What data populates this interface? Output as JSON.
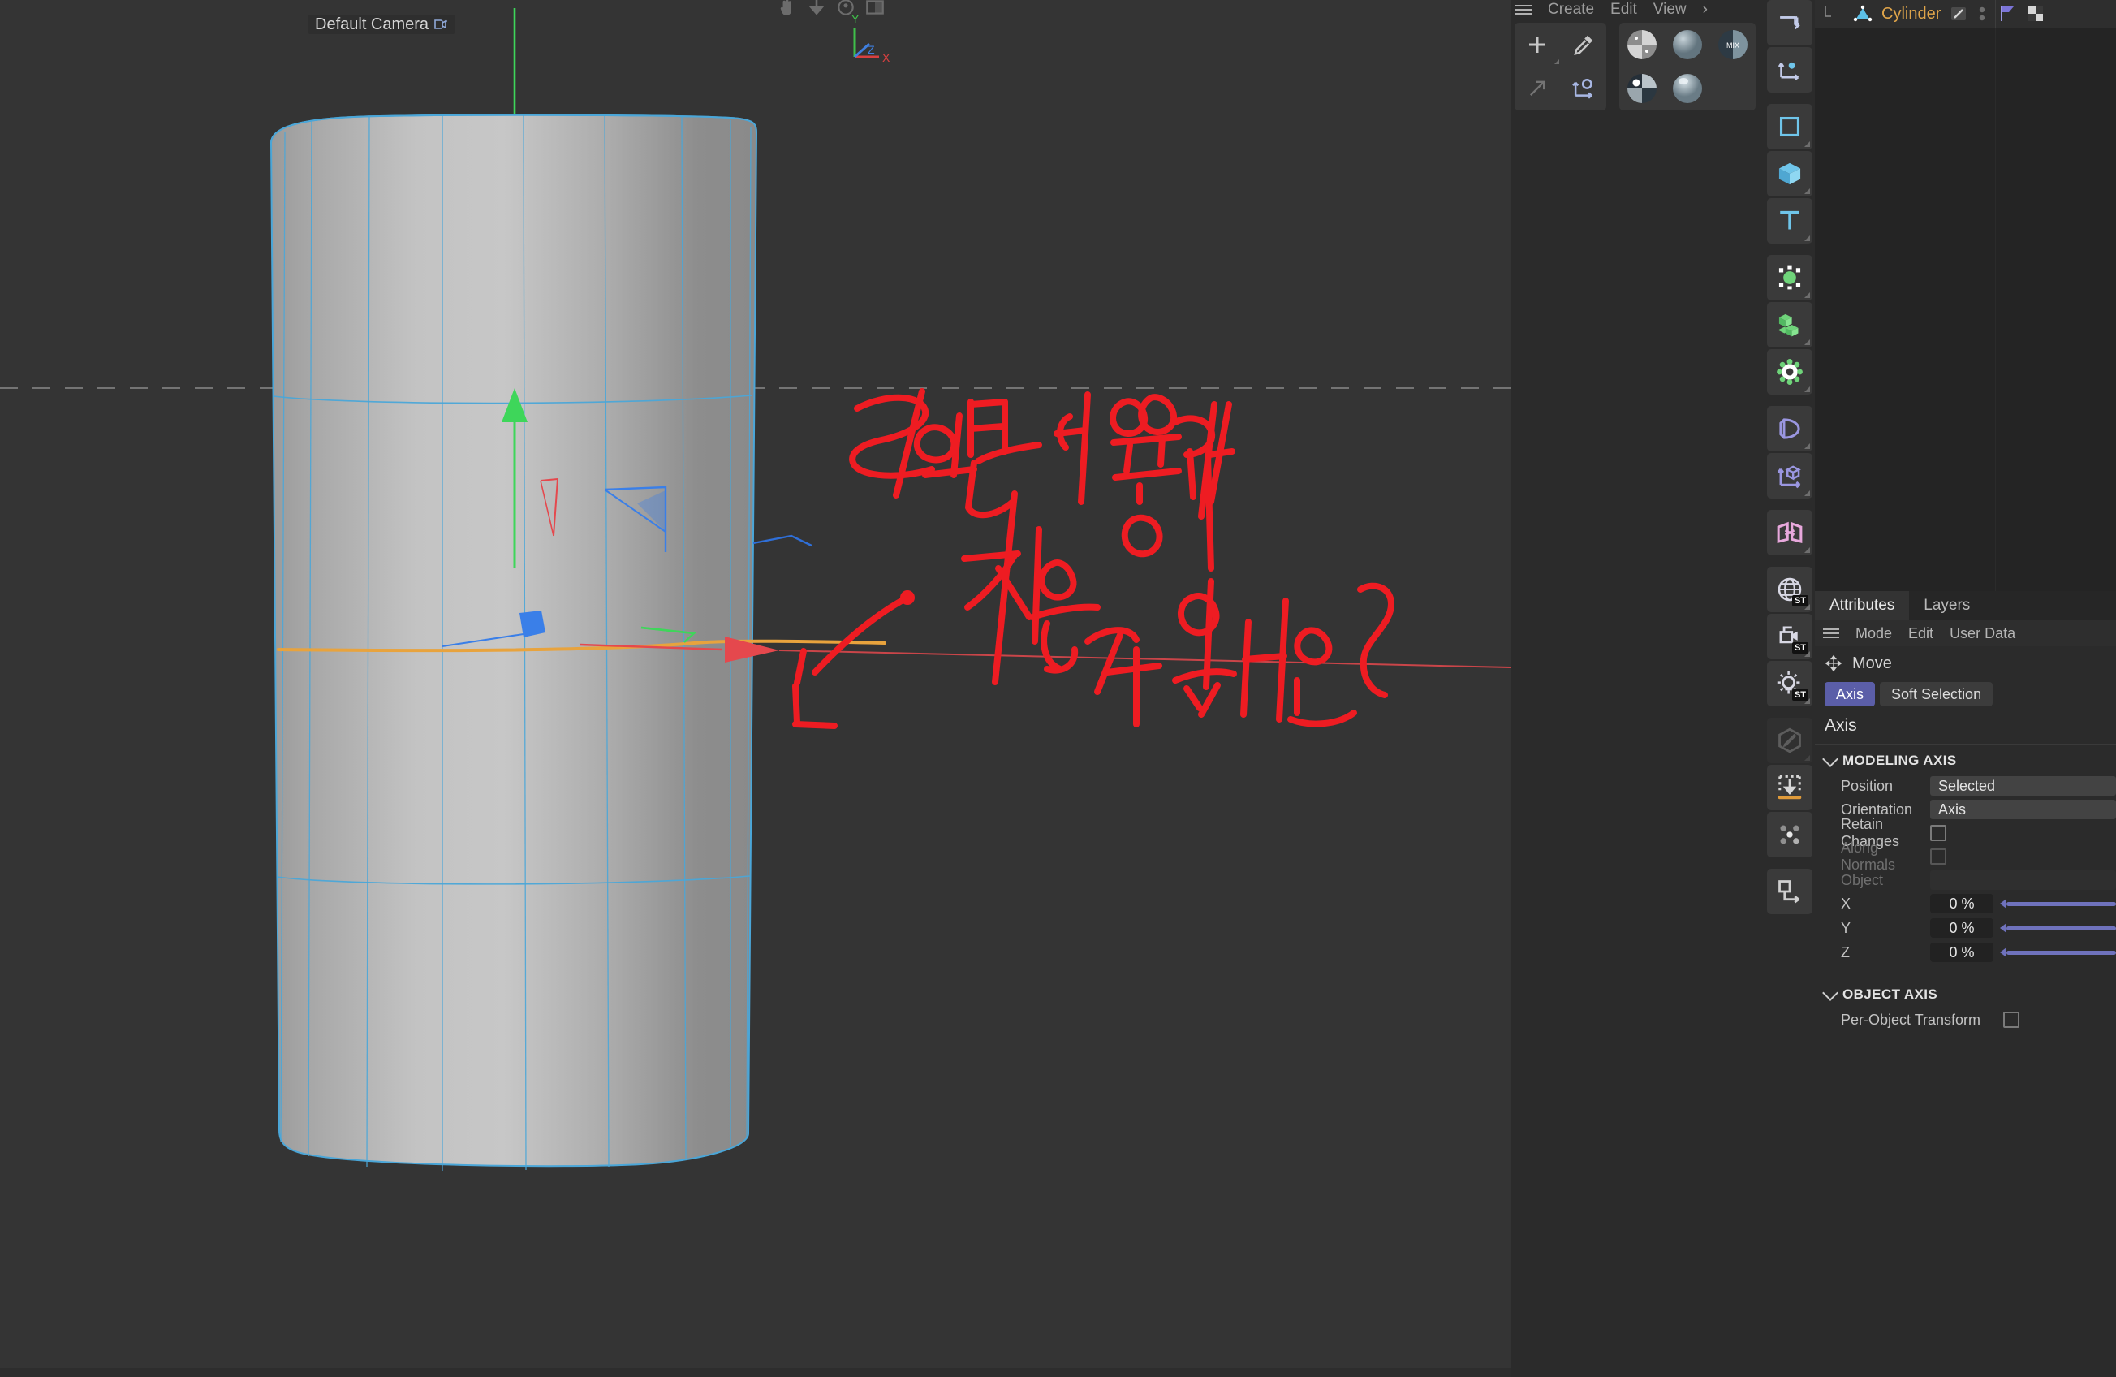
{
  "app": {
    "viewport_label": "Default Camera",
    "camera_icon": "camera-icon"
  },
  "axis_gizmo": {
    "y": "Y",
    "z": "Z",
    "x": "X",
    "colors": {
      "y": "#3fbf4a",
      "z": "#3f7fe0",
      "x": "#d94040"
    }
  },
  "viewport_toolbar": {
    "icons": [
      "pan-hand-icon",
      "move-down-icon",
      "camera-target-icon",
      "layout-split-icon"
    ]
  },
  "object_menu": {
    "hamburger": "menu-icon",
    "items": [
      "Create",
      "Edit",
      "View",
      "›"
    ]
  },
  "material_toolbar": {
    "buttons": [
      "plus-icon",
      "eyedropper-icon",
      "arrow-up-right-icon",
      "axis-rotate-icon"
    ],
    "materials": [
      "checker-sphere-material",
      "gray-sphere-material",
      "mix-sphere-material",
      "shiny-sphere-material",
      "glossy-sphere-material"
    ],
    "mix_label": "MIX"
  },
  "object_manager": {
    "object_name": "Cylinder",
    "object_icon": "cylinder-object-icon",
    "tag_icons": [
      "phong-tag-icon",
      "dots-icon"
    ],
    "layer_icons": [
      "layer-flag-icon",
      "checker-tag-icon"
    ]
  },
  "tool_rail": {
    "groups": [
      {
        "items": [
          {
            "icon": "make-editable-arrow-icon",
            "corner": false,
            "dim": false
          },
          {
            "icon": "axis-center-icon",
            "corner": false,
            "dim": false
          }
        ]
      },
      {
        "items": [
          {
            "icon": "spline-rect-icon",
            "corner": true,
            "dim": false
          },
          {
            "icon": "cube-primitive-icon",
            "corner": true,
            "dim": false
          },
          {
            "icon": "text-tool-icon",
            "corner": true,
            "dim": false
          }
        ]
      },
      {
        "items": [
          {
            "icon": "null-object-icon",
            "corner": true,
            "dim": false
          },
          {
            "icon": "array-object-icon",
            "corner": true,
            "dim": false
          },
          {
            "icon": "gear-generator-icon",
            "corner": true,
            "dim": false
          }
        ]
      },
      {
        "items": [
          {
            "icon": "bend-deformer-icon",
            "corner": true,
            "dim": false
          },
          {
            "icon": "axis-cube-icon",
            "corner": true,
            "dim": false
          }
        ]
      },
      {
        "items": [
          {
            "icon": "symmetry-icon",
            "corner": true,
            "dim": false
          }
        ]
      },
      {
        "items": [
          {
            "icon": "globe-environment-icon",
            "corner": true,
            "dim": false,
            "badge": "ST"
          },
          {
            "icon": "camera-stage-icon",
            "corner": true,
            "dim": false,
            "badge": "ST"
          },
          {
            "icon": "light-icon",
            "corner": true,
            "dim": false,
            "badge": "ST"
          }
        ]
      },
      {
        "items": [
          {
            "icon": "paint-edit-icon",
            "corner": true,
            "dim": true
          },
          {
            "icon": "drop-to-floor-icon",
            "corner": false,
            "dim": false
          },
          {
            "icon": "scatter-points-icon",
            "corner": false,
            "dim": false
          }
        ]
      },
      {
        "items": [
          {
            "icon": "connect-object-icon",
            "corner": false,
            "dim": false
          }
        ]
      }
    ]
  },
  "attributes": {
    "tabs": [
      {
        "label": "Attributes",
        "active": true
      },
      {
        "label": "Layers",
        "active": false
      }
    ],
    "menu": [
      "Mode",
      "Edit",
      "User Data"
    ],
    "tool": {
      "icon": "move-tool-icon",
      "label": "Move"
    },
    "segments": [
      {
        "label": "Axis",
        "active": true
      },
      {
        "label": "Soft Selection",
        "active": false
      }
    ],
    "section_title": "Axis",
    "modeling_axis": {
      "group_label": "MODELING AXIS",
      "fields": [
        {
          "type": "combo",
          "label": "Position",
          "value": "Selected",
          "dim": false
        },
        {
          "type": "combo",
          "label": "Orientation",
          "value": "Axis",
          "dim": false
        },
        {
          "type": "checkbox",
          "label": "Retain Changes",
          "checked": false,
          "dim": false
        },
        {
          "type": "checkbox",
          "label": "Along Normals",
          "checked": false,
          "dim": true
        },
        {
          "type": "combo",
          "label": "Object",
          "value": "",
          "dim": true
        }
      ],
      "sliders": [
        {
          "label": "X",
          "value": "0 %"
        },
        {
          "label": "Y",
          "value": "0 %"
        },
        {
          "label": "Z",
          "value": "0 %"
        }
      ]
    },
    "object_axis": {
      "group_label": "OBJECT AXIS",
      "fields": [
        {
          "type": "checkbox",
          "label": "Per-Object Transform",
          "checked": false,
          "dim": false
        }
      ]
    }
  },
  "annotation": {
    "color": "#ee1c22",
    "line1": "라인만 어떻게",
    "line2": "지울 수 있나요?",
    "arrow": "pointer-arrow"
  },
  "scene": {
    "object": "Cylinder",
    "gizmo": {
      "y_axis_color": "#3ed65a",
      "x_axis_color": "#e5484d",
      "z_handle_color": "#3a7fe8",
      "band_color": "#e8a33d"
    },
    "wire_color": "#4aa6d8"
  }
}
